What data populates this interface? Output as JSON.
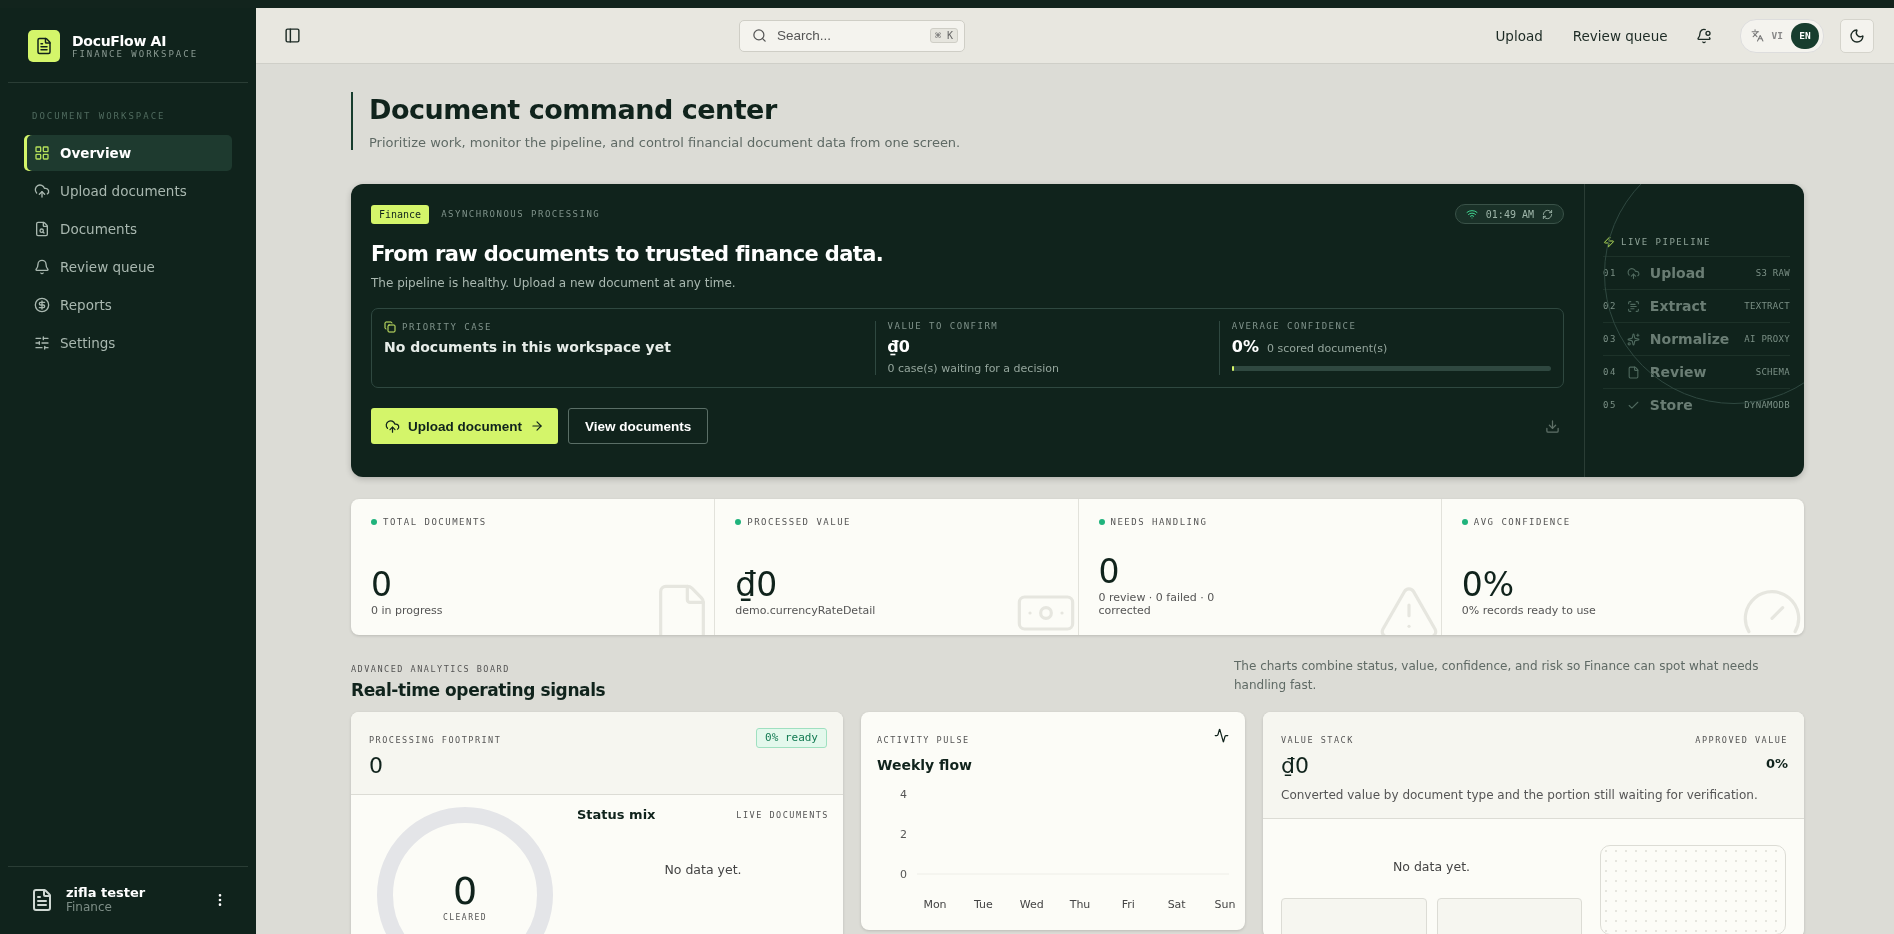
{
  "brand": {
    "name": "DocuFlow AI",
    "subtitle": "FINANCE WORKSPACE"
  },
  "sidebar": {
    "section": "DOCUMENT WORKSPACE",
    "items": [
      {
        "label": "Overview",
        "selected": true
      },
      {
        "label": "Upload documents",
        "selected": false
      },
      {
        "label": "Documents",
        "selected": false
      },
      {
        "label": "Review queue",
        "selected": false
      },
      {
        "label": "Reports",
        "selected": false
      },
      {
        "label": "Settings",
        "selected": false
      }
    ]
  },
  "user": {
    "name": "zifla tester",
    "role": "Finance"
  },
  "topbar": {
    "search_placeholder": "Search...",
    "shortcut": "⌘ K",
    "links": [
      "Upload",
      "Review queue"
    ],
    "languages": [
      {
        "code": "VI",
        "selected": false
      },
      {
        "code": "EN",
        "selected": true
      }
    ]
  },
  "page": {
    "title": "Document command center",
    "subtitle": "Prioritize work, monitor the pipeline, and control financial document data from one screen."
  },
  "hero": {
    "tag": "Finance",
    "mode": "ASYNCHRONOUS PROCESSING",
    "clock": "01:49 AM",
    "headline": "From raw documents to trusted finance data.",
    "status": "The pipeline is healthy. Upload a new document at any time.",
    "priority": {
      "label": "PRIORITY CASE",
      "text": "No documents in this workspace yet"
    },
    "value": {
      "label": "VALUE TO CONFIRM",
      "amount": "₫0",
      "note": "0 case(s) waiting for a decision"
    },
    "confidence": {
      "label": "AVERAGE CONFIDENCE",
      "value": "0%",
      "note": "0 scored document(s)",
      "level": 0
    },
    "primary_button": "Upload document",
    "secondary_button": "View documents",
    "pipeline": {
      "title": "LIVE PIPELINE",
      "steps": [
        {
          "index": "01",
          "name": "Upload",
          "service": "S3 RAW"
        },
        {
          "index": "02",
          "name": "Extract",
          "service": "TEXTRACT"
        },
        {
          "index": "03",
          "name": "Normalize",
          "service": "AI PROXY"
        },
        {
          "index": "04",
          "name": "Review",
          "service": "SCHEMA"
        },
        {
          "index": "05",
          "name": "Store",
          "service": "DYNAMODB"
        }
      ]
    }
  },
  "stats": [
    {
      "label": "TOTAL DOCUMENTS",
      "value": "0",
      "note": "0 in progress"
    },
    {
      "label": "PROCESSED VALUE",
      "value": "₫0",
      "note": "demo.currencyRateDetail"
    },
    {
      "label": "NEEDS HANDLING",
      "value": "0",
      "note": "0 review · 0 failed · 0 corrected"
    },
    {
      "label": "AVG CONFIDENCE",
      "value": "0%",
      "note": "0% records ready to use"
    }
  ],
  "analytics": {
    "eyebrow": "ADVANCED ANALYTICS BOARD",
    "title": "Real-time operating signals",
    "description": "The charts combine status, value, confidence, and risk so Finance can spot what needs handling fast.",
    "footprint": {
      "label": "PROCESSING FOOTPRINT",
      "value": "0",
      "badge": "0% ready",
      "center_value": "0",
      "center_label": "CLEARED",
      "mix_title": "Status mix",
      "mix_label": "LIVE DOCUMENTS",
      "empty": "No data yet."
    },
    "activity": {
      "label": "ACTIVITY PULSE",
      "title": "Weekly flow",
      "chart_data": {
        "type": "line",
        "categories": [
          "Mon",
          "Tue",
          "Wed",
          "Thu",
          "Fri",
          "Sat",
          "Sun"
        ],
        "ylim": [
          0,
          4
        ],
        "yticks": [
          0,
          2,
          4
        ]
      }
    },
    "value_stack": {
      "label": "VALUE STACK",
      "value": "₫0",
      "approved_label": "APPROVED VALUE",
      "approved": "0%",
      "description": "Converted value by document type and the portion still waiting for verification.",
      "empty": "No data yet."
    }
  }
}
